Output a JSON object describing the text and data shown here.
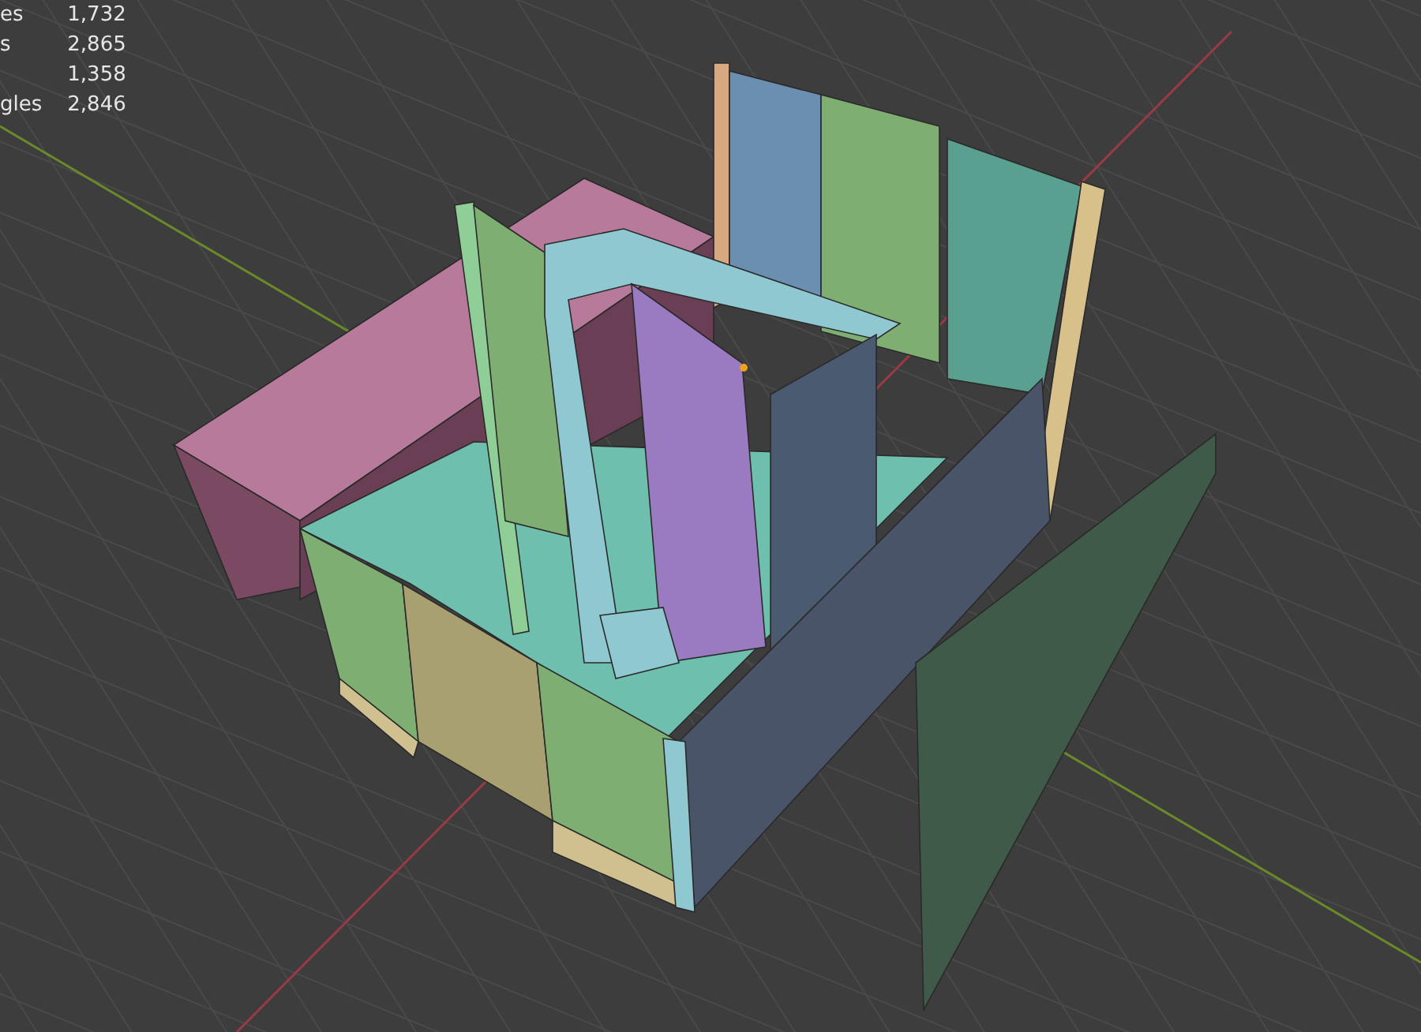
{
  "statistics": [
    {
      "label": "es",
      "value": "1,732"
    },
    {
      "label": "s",
      "value": "2,865"
    },
    {
      "value": "1,358"
    },
    {
      "label": "gles",
      "value": "2,846"
    }
  ]
}
